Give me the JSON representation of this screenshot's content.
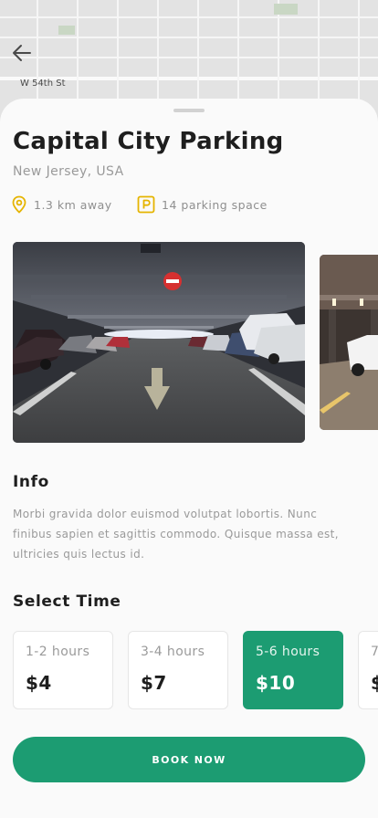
{
  "map": {
    "street_label": "W 54th St"
  },
  "parking": {
    "name": "Capital City Parking",
    "location": "New Jersey, USA",
    "distance": "1.3 km away",
    "parking_spaces": "14 parking space"
  },
  "photos": [
    {
      "description_icon": "garage-photo"
    },
    {
      "description_icon": "garage-photo"
    }
  ],
  "info": {
    "heading": "Info",
    "text": "Morbi gravida dolor euismod volutpat lobortis. Nunc finibus sapien et sagittis commodo. Quisque massa est, ultricies quis lectus id."
  },
  "select_time": {
    "heading": "Select Time",
    "options": [
      {
        "hours": "1-2 hours",
        "price": "$4",
        "selected": false
      },
      {
        "hours": "3-4 hours",
        "price": "$7",
        "selected": false
      },
      {
        "hours": "5-6 hours",
        "price": "$10",
        "selected": true
      },
      {
        "hours": "7",
        "price": "$",
        "selected": false
      }
    ]
  },
  "book_button": {
    "label": "BOOK NOW"
  },
  "colors": {
    "accent": "#1c9c72",
    "icon_yellow": "#e5b400"
  }
}
